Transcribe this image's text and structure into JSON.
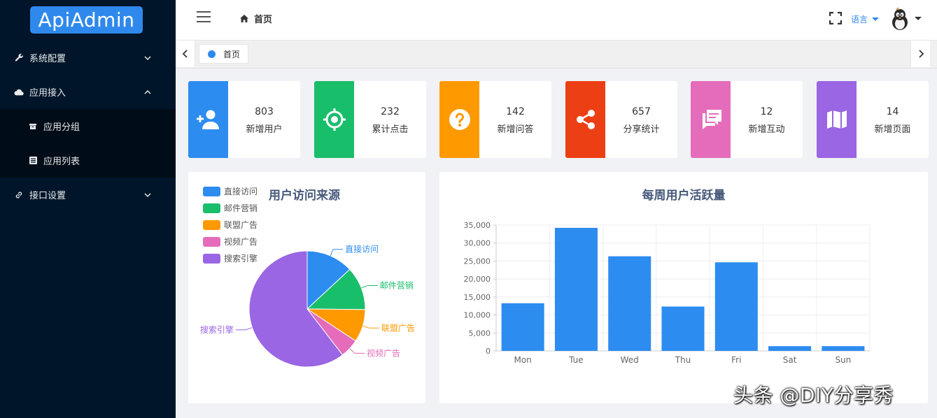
{
  "app": {
    "logo": "ApiAdmin"
  },
  "sidebar": {
    "items": [
      {
        "label": "系统配置",
        "icon": "wrench-icon"
      },
      {
        "label": "应用接入",
        "icon": "cloud-icon"
      },
      {
        "label": "应用分组",
        "icon": "archive-icon"
      },
      {
        "label": "应用列表",
        "icon": "list-icon"
      },
      {
        "label": "接口设置",
        "icon": "link-icon"
      }
    ]
  },
  "header": {
    "breadcrumb": "首页",
    "language": "语言"
  },
  "tabs": [
    {
      "label": "首页"
    }
  ],
  "stats": [
    {
      "value": "803",
      "label": "新增用户",
      "color": "#2d8cf0",
      "icon": "user-add-icon"
    },
    {
      "value": "232",
      "label": "累计点击",
      "color": "#19be6b",
      "icon": "target-icon"
    },
    {
      "value": "142",
      "label": "新增问答",
      "color": "#ff9900",
      "icon": "help-icon"
    },
    {
      "value": "657",
      "label": "分享统计",
      "color": "#ed3f14",
      "icon": "share-icon"
    },
    {
      "value": "12",
      "label": "新增互动",
      "color": "#e46cbb",
      "icon": "chat-icon"
    },
    {
      "value": "14",
      "label": "新增页面",
      "color": "#9a66e4",
      "icon": "map-icon"
    }
  ],
  "chart_data": [
    {
      "type": "pie",
      "title": "用户访问来源",
      "legend_position": "top-left",
      "slices": [
        {
          "name": "直接访问",
          "value": 335,
          "color": "#2d8cf0"
        },
        {
          "name": "邮件营销",
          "value": 310,
          "color": "#19be6b"
        },
        {
          "name": "联盟广告",
          "value": 234,
          "color": "#ff9900"
        },
        {
          "name": "视频广告",
          "value": 135,
          "color": "#e46cbb"
        },
        {
          "name": "搜索引擎",
          "value": 1548,
          "color": "#9a66e4"
        }
      ]
    },
    {
      "type": "bar",
      "title": "每周用户活跃量",
      "categories": [
        "Mon",
        "Tue",
        "Wed",
        "Thu",
        "Fri",
        "Sat",
        "Sun"
      ],
      "values": [
        13253,
        34235,
        26321,
        12340,
        24643,
        1322,
        1324
      ],
      "ylim": [
        0,
        35000
      ],
      "yticks": [
        "0",
        "5,000",
        "10,000",
        "15,000",
        "20,000",
        "25,000",
        "30,000",
        "35,000"
      ],
      "color": "#2d8cf0",
      "grid": true
    }
  ],
  "watermark": "头条 @DIY分享秀"
}
